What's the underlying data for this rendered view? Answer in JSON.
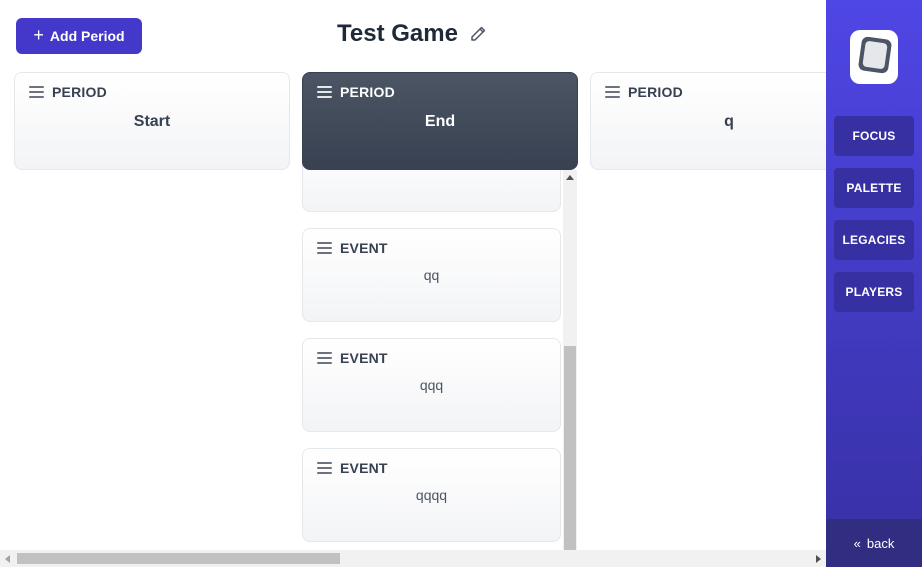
{
  "toolbar": {
    "add_period_label": "Add Period"
  },
  "game": {
    "title": "Test Game"
  },
  "periods": [
    {
      "label": "PERIOD",
      "name": "Start"
    },
    {
      "label": "PERIOD",
      "name": "End"
    },
    {
      "label": "PERIOD",
      "name": "q"
    }
  ],
  "events": [
    {
      "label": "EVENT",
      "name": "qq"
    },
    {
      "label": "EVENT",
      "name": "qqq"
    },
    {
      "label": "EVENT",
      "name": "qqqq"
    }
  ],
  "sidebar": {
    "items": [
      {
        "label": "FOCUS"
      },
      {
        "label": "PALETTE"
      },
      {
        "label": "LEGACIES"
      },
      {
        "label": "PLAYERS"
      }
    ],
    "back_label": "back"
  },
  "colors": {
    "accent": "#4338ca",
    "sidebar": "#4f46e5",
    "selected_card": "#374151"
  }
}
